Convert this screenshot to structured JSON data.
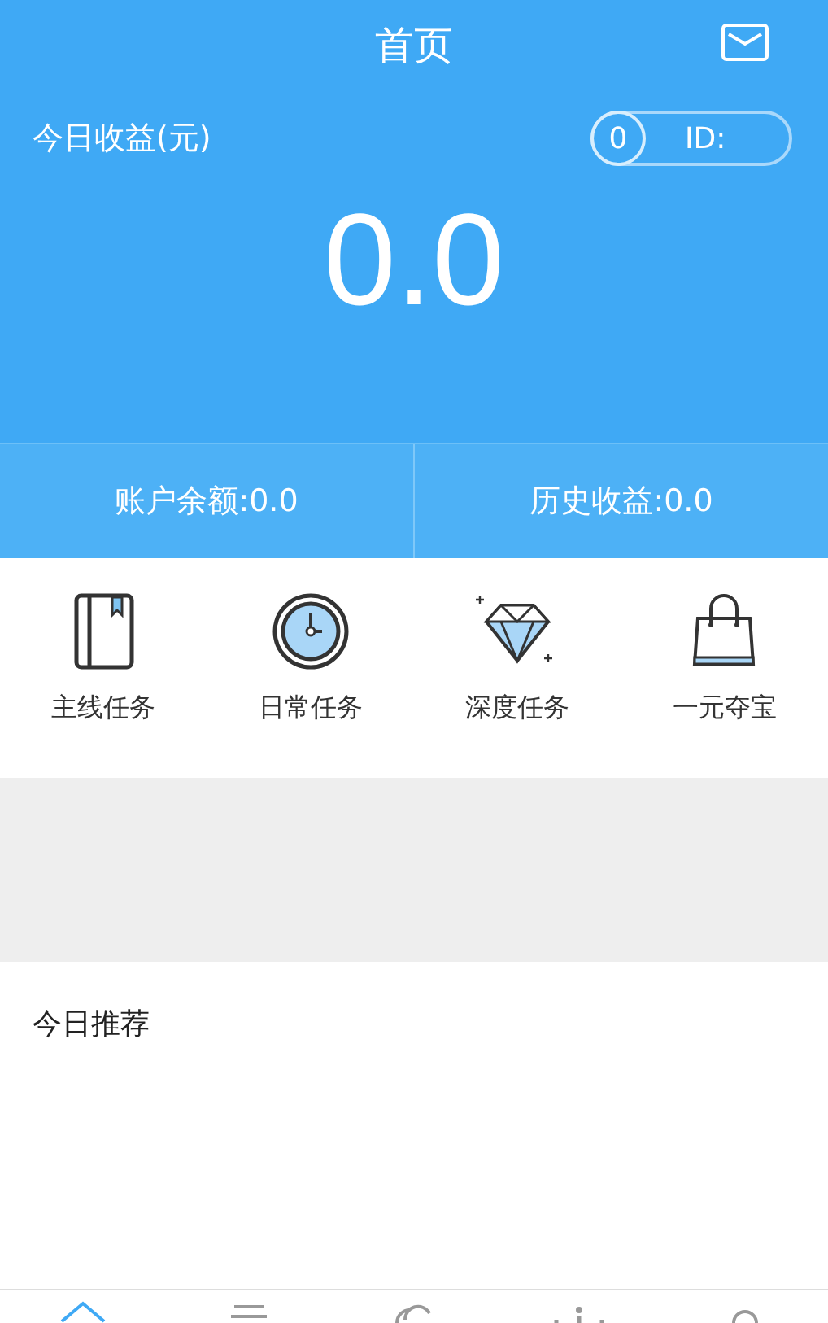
{
  "header": {
    "title": "首页"
  },
  "today": {
    "label": "今日收益(元)",
    "count": "0",
    "id_label": "ID:",
    "amount": "0.0"
  },
  "balances": [
    {
      "label": "账户余额:0.0"
    },
    {
      "label": "历史收益:0.0"
    }
  ],
  "tasks": [
    {
      "kind": "book",
      "label": "主线任务"
    },
    {
      "kind": "clock",
      "label": "日常任务"
    },
    {
      "kind": "diamond",
      "label": "深度任务"
    },
    {
      "kind": "bag",
      "label": "一元夺宝"
    }
  ],
  "recommend": {
    "title": "今日推荐"
  },
  "bottom_nav": [
    {
      "kind": "home",
      "selected": true
    },
    {
      "kind": "list",
      "selected": false
    },
    {
      "kind": "chat",
      "selected": false
    },
    {
      "kind": "dots",
      "selected": false
    },
    {
      "kind": "user",
      "selected": false
    }
  ]
}
